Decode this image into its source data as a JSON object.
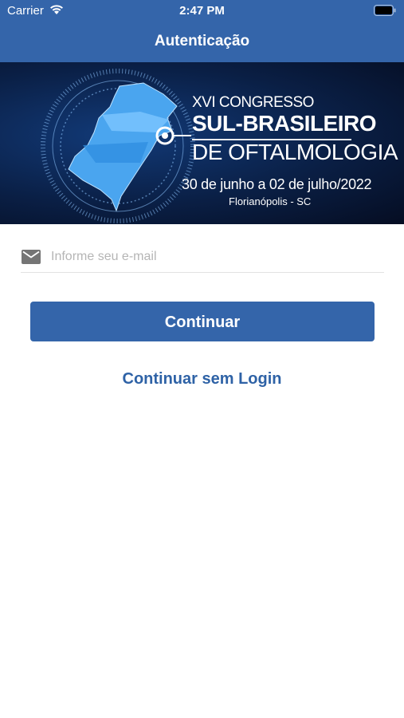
{
  "status_bar": {
    "carrier": "Carrier",
    "time": "2:47 PM"
  },
  "nav": {
    "title": "Autenticação"
  },
  "banner": {
    "line1": "XVI CONGRESSO",
    "line2": "SUL-BRASILEIRO",
    "line3": "DE OFTALMOLOGIA",
    "dates": "30 de junho a 02 de julho/2022",
    "city": "Florianópolis - SC"
  },
  "login": {
    "email_placeholder": "Informe seu e-mail",
    "email_value": "",
    "continue_label": "Continuar",
    "skip_label": "Continuar sem Login"
  },
  "colors": {
    "brand": "#3465aa",
    "link": "#2e62a6"
  },
  "icons": {
    "wifi": "wifi-icon",
    "battery": "battery-icon",
    "email": "envelope-icon"
  }
}
